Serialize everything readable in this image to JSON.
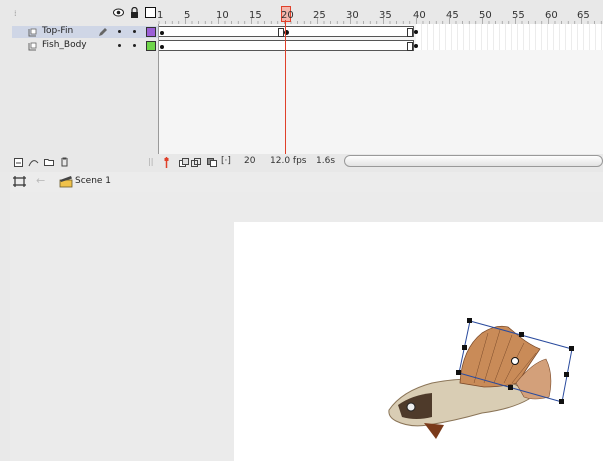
{
  "timeline": {
    "header": {
      "grip_icon": "grip-icon",
      "eye_icon": "eye-icon",
      "lock_icon": "lock-icon",
      "outline_icon": "outline-square-icon"
    },
    "ruler": [
      "1",
      "5",
      "10",
      "15",
      "20",
      "25",
      "30",
      "35",
      "40",
      "45",
      "50",
      "55",
      "60",
      "65"
    ],
    "current_frame_label": "20",
    "layers": [
      {
        "name": "Top-Fin",
        "color": "#9b5fd6",
        "selected": true,
        "icon": "layer-icon",
        "pencil_icon": "pencil-icon"
      },
      {
        "name": "Fish_Body",
        "color": "#6fd64a",
        "selected": false,
        "icon": "layer-icon"
      }
    ],
    "status": {
      "frame": "20",
      "fps": "12.0 fps",
      "time": "1.6s"
    }
  },
  "edit_bar": {
    "scene_label": "Scene 1",
    "scene_icon": "clapperboard-icon",
    "back_icon": "arrow-left-icon",
    "timeline_toggle_icon": "timeline-icon"
  },
  "colors": {
    "playhead": "#e0402a",
    "selection": "#2a4b9e",
    "layer_highlight": "#cfd6e6"
  }
}
